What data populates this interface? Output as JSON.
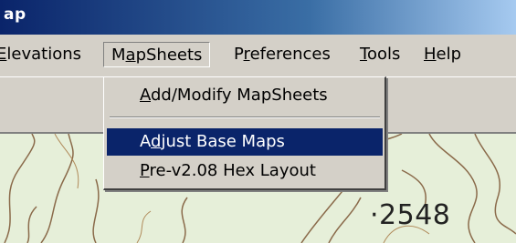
{
  "window": {
    "title": "ap"
  },
  "menubar": {
    "items": [
      {
        "label": "Elevations",
        "accel": "E",
        "pre": "",
        "post": "levations"
      },
      {
        "label": "MapSheets",
        "pre": "M",
        "accel": "a",
        "post": "pSheets"
      },
      {
        "label": "Preferences",
        "pre": "P",
        "accel": "r",
        "post": "eferences"
      },
      {
        "label": "Tools",
        "pre": "",
        "accel": "T",
        "post": "ools"
      },
      {
        "label": "Help",
        "pre": "",
        "accel": "H",
        "post": "elp"
      }
    ]
  },
  "mapsheets_menu": {
    "items": [
      {
        "label": "Add/Modify MapSheets",
        "pre": "",
        "accel": "A",
        "post": "dd/Modify MapSheets",
        "selected": false
      },
      {
        "label": "Adjust Base Maps",
        "pre": "A",
        "accel": "d",
        "post": "just Base Maps",
        "selected": true
      },
      {
        "label": "Pre-v2.08 Hex Layout",
        "pre": "",
        "accel": "P",
        "post": "re-v2.08 Hex Layout",
        "selected": false
      }
    ]
  },
  "map": {
    "elevation_label": "·2548"
  },
  "colors": {
    "selection": "#0a246a",
    "title_gradient_start": "#0a246a",
    "menu_bg": "#d4d0c8",
    "map_bg": "#e6efd9"
  }
}
